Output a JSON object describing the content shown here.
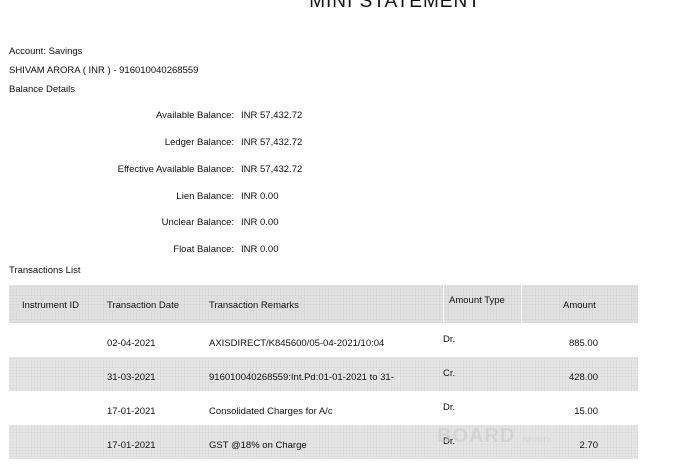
{
  "page_title": "MINI STATEMENT",
  "account": {
    "type_line": "Account:  Savings",
    "holder_line": "SHIVAM ARORA  (  INR  )  -  916010040268559"
  },
  "balance_details_heading": "Balance Details",
  "balances": [
    {
      "label": "Available Balance:",
      "value": "INR 57,432.72"
    },
    {
      "label": "Ledger Balance:",
      "value": "INR 57,432.72"
    },
    {
      "label": "Effective Available Balance:",
      "value": "INR 57,432.72"
    },
    {
      "label": "Lien Balance:",
      "value": "INR 0.00"
    },
    {
      "label": "Unclear Balance:",
      "value": "INR 0.00"
    },
    {
      "label": "Float Balance:",
      "value": "INR 0.00"
    }
  ],
  "transactions_heading": "Transactions List",
  "table": {
    "headers": {
      "instrument_id": "Instrument ID",
      "transaction_date": "Transaction Date",
      "transaction_remarks": "Transaction Remarks",
      "amount_type": "Amount Type",
      "amount": "Amount"
    },
    "rows": [
      {
        "instrument_id": "",
        "date": "02-04-2021",
        "remarks": "AXISDIRECT/K845600/05-04-2021/10:04",
        "type": "Dr.",
        "amount": "885.00"
      },
      {
        "instrument_id": "",
        "date": "31-03-2021",
        "remarks": "916010040268559:Int.Pd:01-01-2021 to 31-",
        "type": "Cr.",
        "amount": "428.00"
      },
      {
        "instrument_id": "",
        "date": "17-01-2021",
        "remarks": "Consolidated Charges for A/c",
        "type": "Dr.",
        "amount": "15.00"
      },
      {
        "instrument_id": "",
        "date": "17-01-2021",
        "remarks": "GST @18% on Charge",
        "type": "Dr.",
        "amount": "2.70"
      }
    ]
  },
  "watermark": {
    "main": "BOARD",
    "sub": "INFINITY"
  }
}
